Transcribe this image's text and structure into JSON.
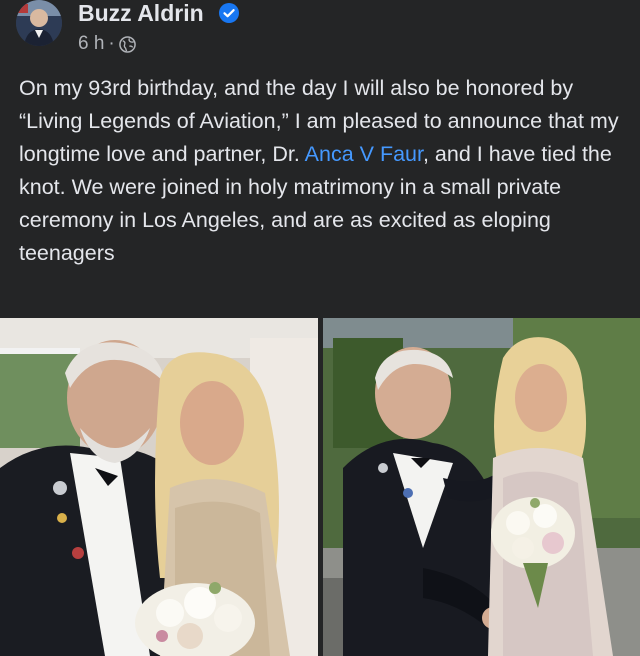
{
  "post": {
    "author": "Buzz Aldrin",
    "verified_icon": "verified-badge-icon",
    "timestamp": "6 h",
    "separator": "·",
    "audience_icon": "globe-icon",
    "text_before": "On my 93rd birthday, and the day I will also be honored by “Living Legends of Aviation,” I am pleased to announce that my longtime love and partner, Dr. ",
    "mention": "Anca V Faur",
    "text_after": ", and I have tied the knot. We were joined in holy matrimony in a small private ceremony in Los Angeles, and are as excited as eloping teenagers"
  },
  "colors": {
    "background": "#242526",
    "text": "#e4e6eb",
    "secondary_text": "#b0b3b8",
    "link": "#4599ff",
    "verified": "#1877f2"
  }
}
